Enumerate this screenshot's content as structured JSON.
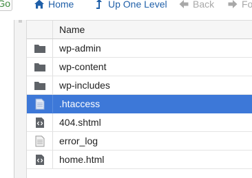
{
  "toolbar": {
    "go_label": "Go",
    "home_label": "Home",
    "up_label": "Up One Level",
    "back_label": "Back",
    "forward_label": "Fo"
  },
  "table": {
    "name_header": "Name",
    "rows": [
      {
        "name": "wp-admin",
        "icon": "folder-icon"
      },
      {
        "name": "wp-content",
        "icon": "folder-icon"
      },
      {
        "name": "wp-includes",
        "icon": "folder-icon"
      },
      {
        "name": ".htaccess",
        "icon": "text-file-icon",
        "selected": true
      },
      {
        "name": "404.shtml",
        "icon": "code-file-icon"
      },
      {
        "name": "error_log",
        "icon": "text-file-icon"
      },
      {
        "name": "home.html",
        "icon": "code-file-icon"
      }
    ]
  },
  "colors": {
    "selected_row": "#3d78d8",
    "link_blue": "#1f5fa8",
    "disabled_gray": "#a8a8a8",
    "go_green": "#3c8a3c"
  }
}
